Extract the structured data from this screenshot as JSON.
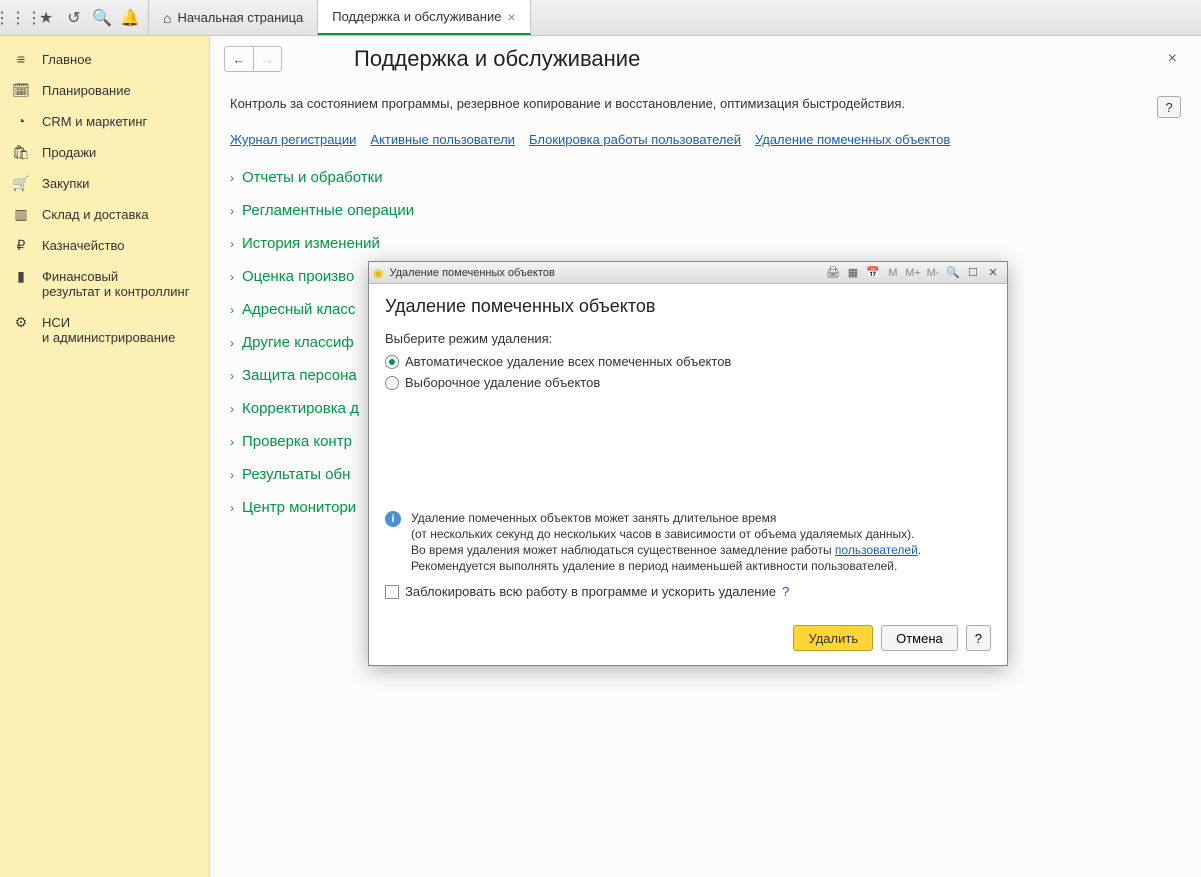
{
  "tabs": {
    "home": "Начальная страница",
    "active": "Поддержка и обслуживание"
  },
  "sidebar": [
    {
      "icon": "≡",
      "label": "Главное"
    },
    {
      "icon": "🗓",
      "label": "Планирование"
    },
    {
      "icon": "◔",
      "label": "CRM и маркетинг"
    },
    {
      "icon": "🛍",
      "label": "Продажи"
    },
    {
      "icon": "🛒",
      "label": "Закупки"
    },
    {
      "icon": "▥",
      "label": "Склад и доставка"
    },
    {
      "icon": "₽",
      "label": "Казначейство"
    },
    {
      "icon": "▮",
      "label": "Финансовый\nрезультат и контроллинг"
    },
    {
      "icon": "⚙",
      "label": "НСИ\nи администрирование"
    }
  ],
  "page": {
    "title": "Поддержка и обслуживание",
    "desc": "Контроль за состоянием программы, резервное копирование и восстановление, оптимизация быстродействия.",
    "help": "?",
    "links": [
      "Журнал регистрации",
      "Активные пользователи",
      "Блокировка работы пользователей",
      "Удаление помеченных объектов"
    ],
    "sections": [
      "Отчеты и обработки",
      "Регламентные операции",
      "История изменений",
      "Оценка произво",
      "Адресный класс",
      "Другие классиф",
      "Защита персона",
      "Корректировка д",
      "Проверка контр",
      "Результаты обн",
      "Центр монитори"
    ]
  },
  "dialog": {
    "winTitle": "Удаление помеченных объектов",
    "tbtns": {
      "m": "M",
      "mplus": "M+",
      "mminus": "M-"
    },
    "heading": "Удаление помеченных объектов",
    "modeLabel": "Выберите режим удаления:",
    "opt1": "Автоматическое удаление всех помеченных объектов",
    "opt2": "Выборочное удаление объектов",
    "info1": "Удаление помеченных объектов может занять длительное время",
    "info2": "(от нескольких секунд до нескольких часов в зависимости от объема удаляемых данных).",
    "info3a": "Во время удаления может наблюдаться существенное замедление работы ",
    "info3link": "пользователей",
    "info3b": ".",
    "info4": "Рекомендуется выполнять удаление в период наименьшей активности пользователей.",
    "block": "Заблокировать всю работу в программе и ускорить удаление",
    "q": "?",
    "delete": "Удалить",
    "cancel": "Отмена",
    "help": "?"
  }
}
